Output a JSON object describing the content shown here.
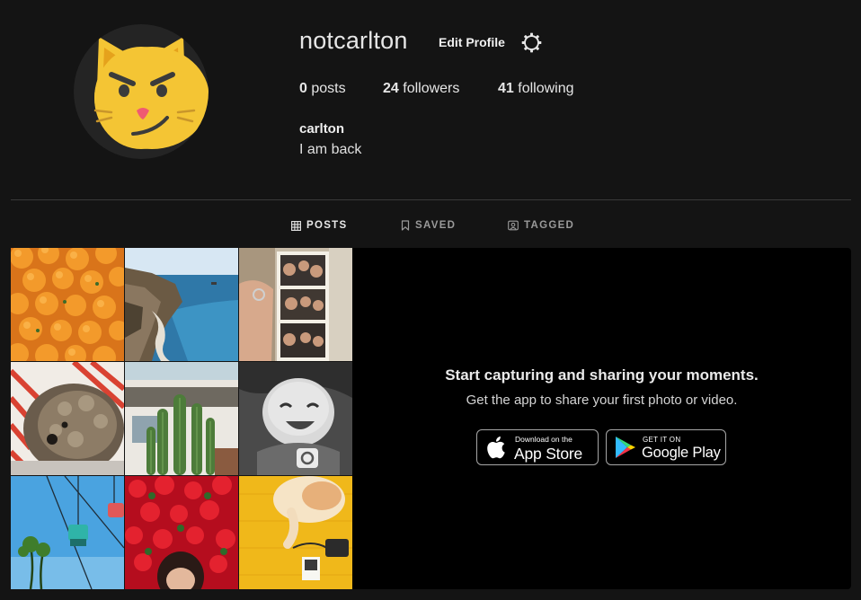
{
  "profile": {
    "username": "notcarlton",
    "edit_label": "Edit Profile",
    "display_name": "carlton",
    "bio": "I am back",
    "avatar_icon": "smirking-cat-face",
    "settings_icon": "gear-icon"
  },
  "stats": [
    {
      "count": "0",
      "label": "posts"
    },
    {
      "count": "24",
      "label": "followers"
    },
    {
      "count": "41",
      "label": "following"
    }
  ],
  "tabs": [
    {
      "label": "POSTS",
      "icon": "grid-icon",
      "active": true
    },
    {
      "label": "SAVED",
      "icon": "bookmark-icon",
      "active": false
    },
    {
      "label": "TAGGED",
      "icon": "tag-portrait-icon",
      "active": false
    }
  ],
  "grid": [
    "oranges",
    "coast",
    "photo-strip",
    "dog",
    "cactus",
    "baby",
    "gondola",
    "red-flowers",
    "cat"
  ],
  "promo": {
    "title": "Start capturing and sharing your moments.",
    "subtitle": "Get the app to share your first photo or video.",
    "app_store": {
      "small": "Download on the",
      "big": "App Store"
    },
    "google_play": {
      "small": "GET IT ON",
      "big": "Google Play"
    }
  },
  "colors": {
    "background": "#141414",
    "promo_background": "#000000",
    "avatar_yellow": "#f4c534"
  }
}
